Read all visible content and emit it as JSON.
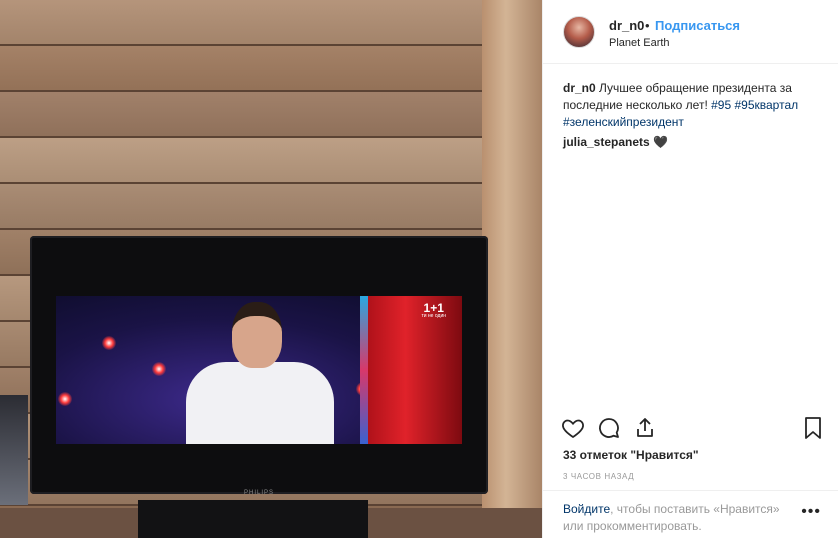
{
  "post": {
    "username": "dr_n0",
    "separator": "•",
    "follow_label": "Подписаться",
    "location": "Planet Earth"
  },
  "caption": {
    "username": "dr_n0",
    "text": "Лучшее обращение президента за последние несколько лет!",
    "tags": [
      "#95",
      "#95квартал",
      "#зеленскийпрезидент"
    ]
  },
  "comments": [
    {
      "username": "julia_stepanets",
      "text": "🖤"
    }
  ],
  "photo": {
    "tv_brand": "PHILIPS",
    "channel_logo": "1+1",
    "channel_slogan": "ти не один"
  },
  "actions": {
    "like_icon": "heart-icon",
    "comment_icon": "comment-icon",
    "share_icon": "share-icon",
    "save_icon": "bookmark-icon"
  },
  "likes": "33 отметок \"Нравится\"",
  "timestamp": "3 ЧАСОВ НАЗАД",
  "footer": {
    "login_link": "Войдите",
    "login_text": ", чтобы поставить «Нравится» или прокомментировать.",
    "more_label": "•••"
  },
  "colors": {
    "link": "#3897f0",
    "hashtag": "#003569",
    "muted": "#999999"
  }
}
